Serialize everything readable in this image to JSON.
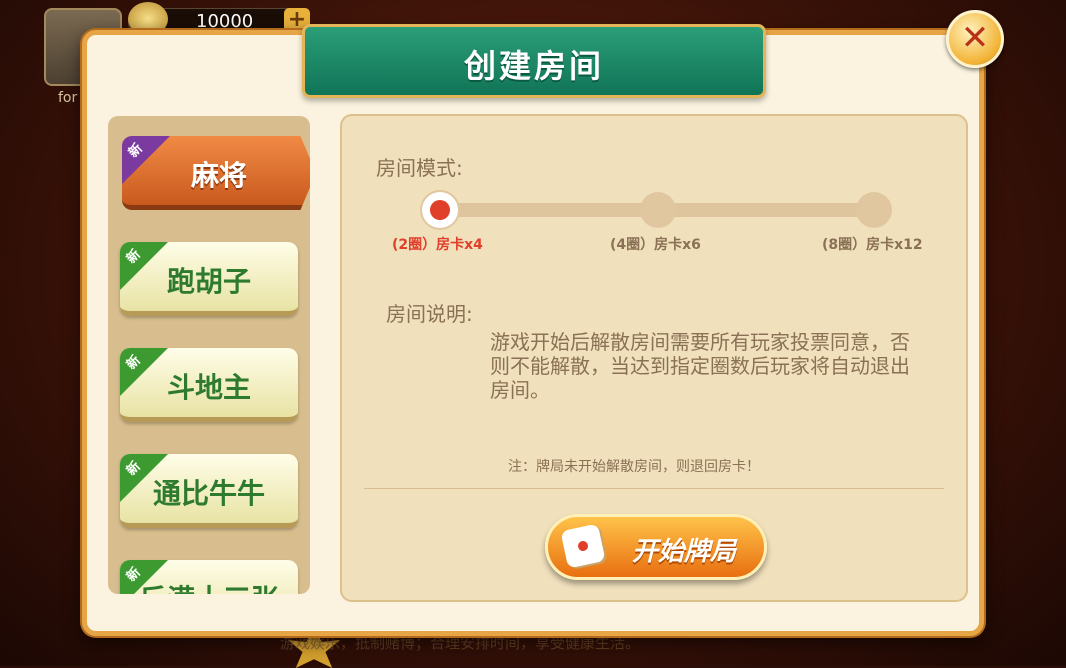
{
  "background": {
    "user_name": "for",
    "coins": "10000",
    "plus_icon": "plus-icon",
    "footer": "游戏娱乐，抵制赌博；合理安排时间，享受健康生活。"
  },
  "dialog": {
    "title": "创建房间",
    "close_icon": "close-x-icon",
    "tabs": [
      {
        "label": "麻将",
        "badge": "新",
        "active": true
      },
      {
        "label": "跑胡子",
        "badge": "新",
        "active": false
      },
      {
        "label": "斗地主",
        "badge": "新",
        "active": false
      },
      {
        "label": "通比牛牛",
        "badge": "新",
        "active": false
      },
      {
        "label": "斤满十三张",
        "badge": "新",
        "active": false
      }
    ],
    "mode_label": "房间模式:",
    "modes": [
      {
        "label": "(2圈）房卡x4",
        "selected": true
      },
      {
        "label": "(4圈）房卡x6",
        "selected": false
      },
      {
        "label": "(8圈）房卡x12",
        "selected": false
      }
    ],
    "desc_label": "房间说明:",
    "desc_text": "游戏开始后解散房间需要所有玩家投票同意，否则不能解散，当达到指定圈数后玩家将自动退出房间。",
    "note": "注：牌局未开始解散房间，则退回房卡！",
    "start_button": "开始牌局",
    "colors": {
      "accent_green": "#107456",
      "selected_red": "#e0402a",
      "button_orange": "#e86f10"
    }
  }
}
